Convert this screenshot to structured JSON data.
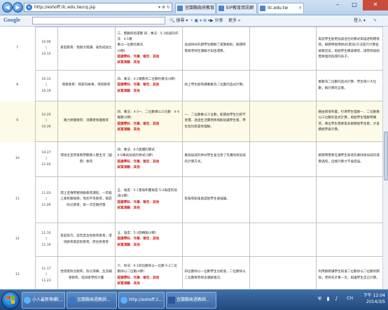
{
  "browser": {
    "url": "http://eshoff.ilc.edu.tw/cq.jsp",
    "tabs": [
      {
        "label": "宜蘭縣政府教育"
      },
      {
        "label": "EIP教育資訊網"
      },
      {
        "label": "ilc.edu.tw"
      }
    ]
  },
  "google_toolbar": {
    "logo": "Google",
    "search_label": "搜尋",
    "share_label": "分享",
    "more_label": "更多 »",
    "signin_label": "登入"
  },
  "table": {
    "rows": [
      {
        "no": "7",
        "weeks": [
          "10.06",
          "|",
          "10.12"
        ],
        "topic": "家庭教育：我跟文閱讀、角色成長比",
        "unit": [
          "三、整數四則運算 四、乘法：5-3加減的作法　4-1數",
          "乘以一位數的乘法"
        ],
        "unit_weeks": "(4節)",
        "unit_tag": "認識學科．作業．報告．其他",
        "evaluation": "試寫測驗．其他",
        "objective": "加減併式的題學生瞭解了運算規則，解題時需要老師在講解才知道運算。",
        "guide1": "",
        "guide2": "再從學生能用加減混合的算式來描述問題情境，解題時能用併式(累加)方法進行計算並檢驗答案，再給學生機會練習，請老師協助需要個別指導的孩子。",
        "hl": false
      },
      {
        "no": "8",
        "weeks": [
          "10.13",
          "|",
          "10.19"
        ],
        "topic": "環教教育：我家的故事，環境教育",
        "unit": [
          "四、乘法：4-2乘數為二位數的乘法(4節)"
        ],
        "unit_weeks": "",
        "unit_tag": "認識學科．作業．報告．其他",
        "evaluation": "試寫測驗．其他",
        "objective": "除上學生能熟練乘數為二位數的直式計算。",
        "guide1": "",
        "guide2": "乘數為二位數的直式計算，學生缺少大位數，解計算的正確。",
        "hl": false
      },
      {
        "no": "9",
        "weeks": [
          "10.20",
          "|",
          "10.26"
        ],
        "topic": "兩力保健教育：消費者保護教育",
        "unit": [
          "四、乘法：4-3一．二位數乘以三位數　4-4概數(4節)"
        ],
        "unit_weeks": "",
        "unit_tag": "認識學科．作業．報告．其他",
        "evaluation": "試寫測驗．其他",
        "objective": "一．二位數乘以三位數，能開始學生比較不習慣，透過生活實例情境解說讓學生看，學生就比較容易理解。",
        "guide1": "",
        "guide2": "藉由情境布置，引導學生理解一．二位數乘以三位數的直式計算，再給學生理解時練習，將位學生需要再多解題給學生看，才會積極學會計算。",
        "hl": true
      },
      {
        "no": "10",
        "weeks": [
          "10.27",
          "|",
          "11.02"
        ],
        "topic": "環境主宣所家教學觀察入壓生活（國際）教育",
        "unit": [
          "四、乘法：6-5連續的算式",
          "4-6乘與加減的併式(4節)"
        ],
        "unit_weeks": "",
        "unit_tag": "認識學科．作業．報告．其他",
        "evaluation": "試寫測驗．其他",
        "objective": "乘與加減的併式學生會注意了先乘除後加減的計算方式。",
        "guide1": "",
        "guide2": "解題時需要在讀學生知道先乘除後加減的運算過程，這樣計算才不會錯誤。",
        "hl": false
      },
      {
        "no": "11",
        "weeks": [
          "11.03",
          "|",
          "11.09"
        ],
        "topic": "環土宣傳學觀清動教育課程，一年級上家校聯絡教，性別平等教育，家庭防災教育，第一次定期評量",
        "unit": [
          "五、角度：5-1量角和畫角度 5-2角度的加減(4節)"
        ],
        "unit_weeks": "",
        "unit_tag": "認識學科．作業．報告．其他",
        "evaluation": "試寫測驗．其他",
        "objective": "就角和銳角角度給學生會描繪。",
        "guide1": "",
        "guide2": "",
        "hl": false
      },
      {
        "no": "12",
        "weeks": [
          "11.10",
          "|",
          "11.16"
        ],
        "topic": "家庭技巧，寫年度含性教育教育，環境教育家庭別教育，原住民教育",
        "unit": [
          "五、角度：5-3旋轉角(4節)"
        ],
        "unit_weeks": "",
        "unit_tag": "認識學科．作業．報告．其他",
        "evaluation": "試寫測驗．其他",
        "objective": "",
        "guide1": "",
        "guide2": "",
        "hl": false
      },
      {
        "no": "13",
        "weeks": [
          "11.17",
          "|",
          "11.23"
        ],
        "topic": "性侵害防治教育，防災演練，生涯輔導教育，就排家學校計畫",
        "unit": [
          "六．除法：6-1四位數除以一位數 6-2二位數除以二位數(4節)"
        ],
        "unit_weeks": "",
        "unit_tag": "認識學科．作業．報告．其他",
        "evaluation": "試寫測驗．其他",
        "objective": "四位數除以一位數學生比較會，二位數除以二位數要老師多講解幾次。",
        "guide1": "",
        "guide2": "利用解題讓學生知道二位數除以二位數的關係，老師先計算一次，再讓學生自己計算。",
        "hl": false
      }
    ]
  },
  "taskbar": {
    "items": [
      {
        "label": "小人最新專欄(..."
      },
      {
        "label": "宜蘭縣高週教師..."
      },
      {
        "label": "http://eshoff.il..."
      },
      {
        "label": "宜蘭縣高週教師..."
      }
    ],
    "lang": "CH",
    "time": "下午 12:04",
    "date": "2014/3/5"
  }
}
